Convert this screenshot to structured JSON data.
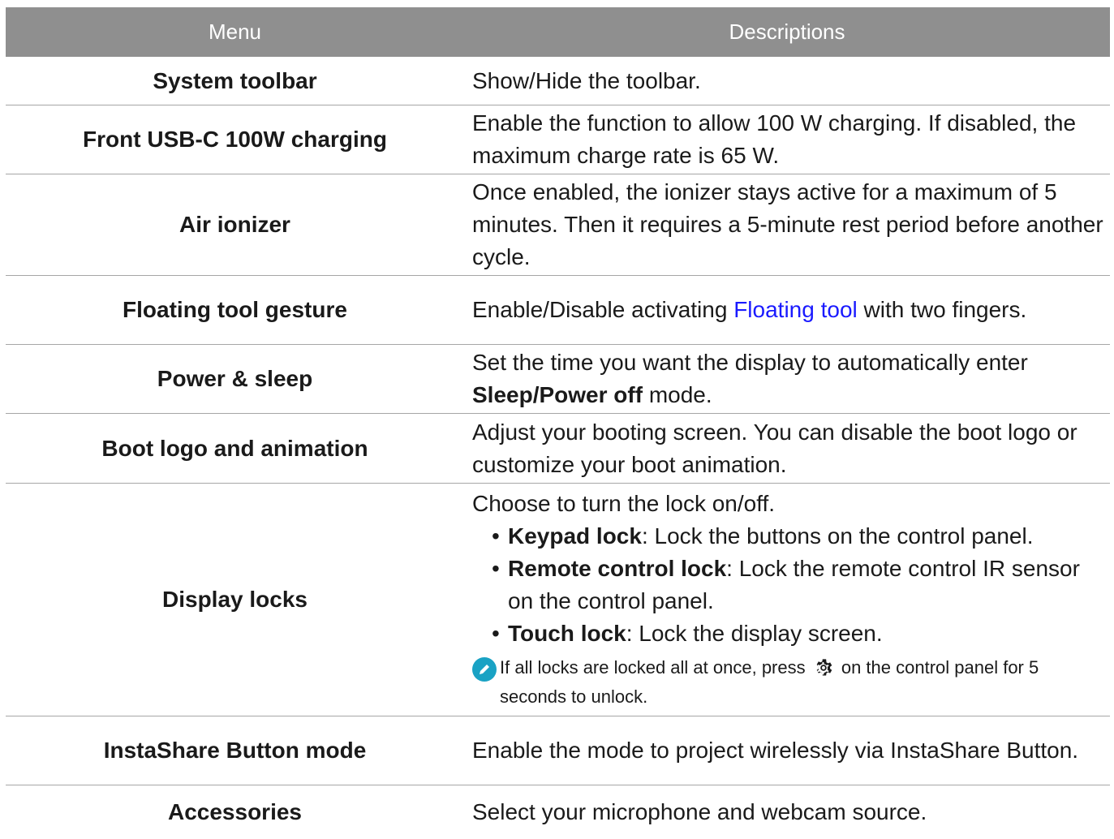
{
  "header": {
    "menu": "Menu",
    "descriptions": "Descriptions"
  },
  "rows": [
    {
      "menu": "System toolbar",
      "desc": "Show/Hide the toolbar."
    },
    {
      "menu": "Front USB-C 100W charging",
      "desc": "Enable the function to allow 100 W charging. If disabled, the maximum charge rate is 65 W."
    },
    {
      "menu": "Air ionizer",
      "desc": "Once enabled, the ionizer stays active for a maximum of 5 minutes. Then it requires a 5-minute rest period before another cycle."
    },
    {
      "menu": "Floating tool gesture",
      "desc_pre": "Enable/Disable activating ",
      "desc_link": "Floating tool",
      "desc_post": " with two fingers."
    },
    {
      "menu": "Power & sleep",
      "desc_pre": "Set the time you want the display to automatically enter ",
      "desc_b1": "Sleep",
      "desc_mid": "/",
      "desc_b2": "Power off",
      "desc_post": " mode."
    },
    {
      "menu": "Boot logo and animation",
      "desc": "Adjust your booting screen. You can disable the boot logo or customize your boot animation."
    },
    {
      "menu": "Display locks",
      "desc": "Choose to turn the lock on/off.",
      "bullets": [
        {
          "bold": "Keypad lock",
          "text": ": Lock the buttons on the control panel."
        },
        {
          "bold": "Remote control lock",
          "text": ": Lock the remote control IR sensor on the control panel."
        },
        {
          "bold": "Touch lock",
          "text": ": Lock the display screen."
        }
      ],
      "note_pre": "If all locks are locked all at once, press ",
      "note_post": " on the control panel for 5 seconds to unlock.",
      "note_icon": "pencil-icon",
      "gear_icon": "gear-icon"
    },
    {
      "menu": "InstaShare Button mode",
      "desc": "Enable the mode to project wirelessly via InstaShare Button."
    },
    {
      "menu": "Accessories",
      "desc": "Select your microphone and webcam source."
    }
  ],
  "colors": {
    "header_bg": "#8f8f8f",
    "link": "#1a1aff",
    "note_icon": "#19a2c4"
  }
}
